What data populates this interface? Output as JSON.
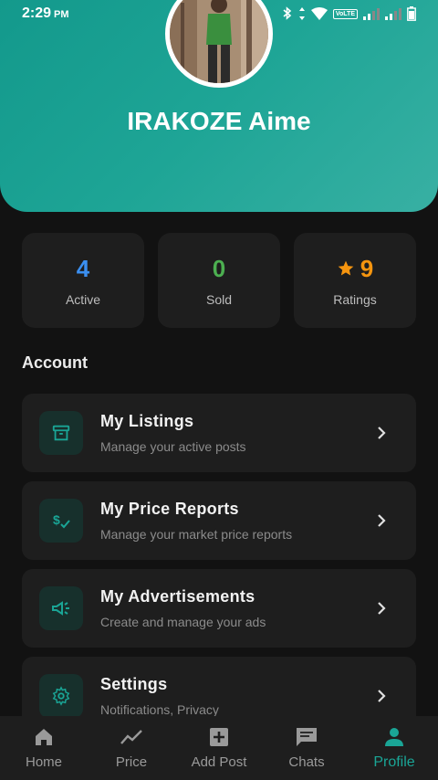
{
  "status_bar": {
    "time": "2:29",
    "ampm": "PM",
    "volte_label": "VoLTE"
  },
  "profile": {
    "name": "IRAKOZE Aime"
  },
  "stats": [
    {
      "value": "4",
      "label": "Active",
      "color": "#3b8ff0"
    },
    {
      "value": "0",
      "label": "Sold",
      "color": "#4caf50"
    },
    {
      "value": "9",
      "label": "Ratings",
      "color": "#f5950f",
      "icon": "star-icon"
    }
  ],
  "account": {
    "section_title": "Account",
    "items": [
      {
        "title": "My Listings",
        "subtitle": "Manage your active posts",
        "icon": "archive-box-icon"
      },
      {
        "title": "My Price Reports",
        "subtitle": "Manage your market price reports",
        "icon": "price-check-icon"
      },
      {
        "title": "My Advertisements",
        "subtitle": "Create and manage your ads",
        "icon": "megaphone-icon"
      },
      {
        "title": "Settings",
        "subtitle": "Notifications, Privacy",
        "icon": "gear-icon"
      }
    ]
  },
  "bottom_nav": {
    "items": [
      {
        "label": "Home",
        "icon": "home-icon"
      },
      {
        "label": "Price",
        "icon": "trending-line-icon"
      },
      {
        "label": "Add Post",
        "icon": "add-box-icon"
      },
      {
        "label": "Chats",
        "icon": "chat-bubble-icon"
      },
      {
        "label": "Profile",
        "icon": "person-icon",
        "active": true
      }
    ]
  },
  "colors": {
    "accent": "#1aa596",
    "background": "#121212",
    "card": "#1e1e1e"
  }
}
